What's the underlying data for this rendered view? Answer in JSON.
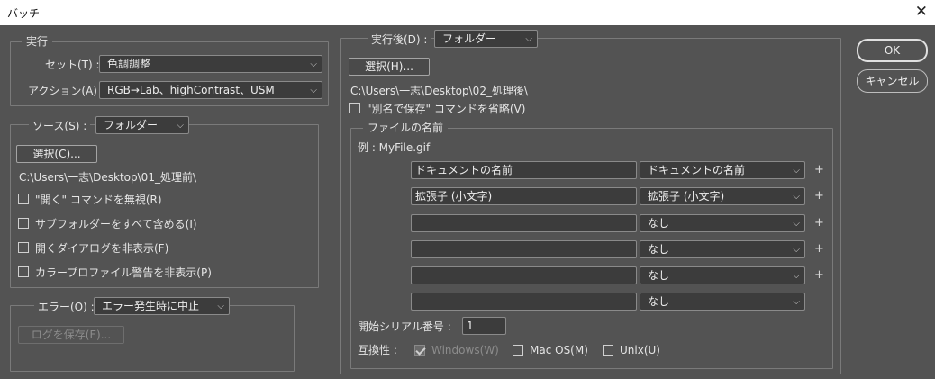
{
  "window": {
    "title": "バッチ",
    "close_glyph": "✕"
  },
  "play": {
    "legend": "実行",
    "set_label": "セット(T) :",
    "set_value": "色調調整",
    "action_label": "アクション(A) :",
    "action_value": "RGB→Lab、highContrast、USM"
  },
  "source": {
    "label": "ソース(S) :",
    "value": "フォルダー",
    "choose_label": "選択(C)...",
    "path": "C:\\Users\\一志\\Desktop\\01_処理前\\",
    "options": [
      {
        "label": "\"開く\" コマンドを無視(R)",
        "checked": false
      },
      {
        "label": "サブフォルダーをすべて含める(I)",
        "checked": false
      },
      {
        "label": "開くダイアログを非表示(F)",
        "checked": false
      },
      {
        "label": "カラープロファイル警告を非表示(P)",
        "checked": false
      }
    ]
  },
  "errors": {
    "label": "エラー(O) :",
    "value": "エラー発生時に中止",
    "save_log_label": "ログを保存(E)..."
  },
  "destination": {
    "label": "実行後(D) :",
    "value": "フォルダー",
    "choose_label": "選択(H)...",
    "path": "C:\\Users\\一志\\Desktop\\02_処理後\\",
    "override_label": "\"別名で保存\" コマンドを省略(V)",
    "override_checked": false
  },
  "naming": {
    "legend": "ファイルの名前",
    "example": "例 : MyFile.gif",
    "rows": [
      {
        "text": "ドキュメントの名前",
        "select": "ドキュメントの名前",
        "plus": "+"
      },
      {
        "text": "拡張子 (小文字)",
        "select": "拡張子 (小文字)",
        "plus": "+"
      },
      {
        "text": "",
        "select": "なし",
        "plus": "+"
      },
      {
        "text": "",
        "select": "なし",
        "plus": "+"
      },
      {
        "text": "",
        "select": "なし",
        "plus": "+"
      },
      {
        "text": "",
        "select": "なし",
        "plus": ""
      }
    ],
    "serial_label": "開始シリアル番号 :",
    "serial_value": "1",
    "compat_label": "互換性 :",
    "compat": [
      {
        "label": "Windows(W)",
        "checked": true,
        "disabled": true
      },
      {
        "label": "Mac OS(M)",
        "checked": false,
        "disabled": false
      },
      {
        "label": "Unix(U)",
        "checked": false,
        "disabled": false
      }
    ]
  },
  "buttons": {
    "ok": "OK",
    "cancel": "キャンセル"
  },
  "icons": {
    "chevron": "⌵"
  }
}
